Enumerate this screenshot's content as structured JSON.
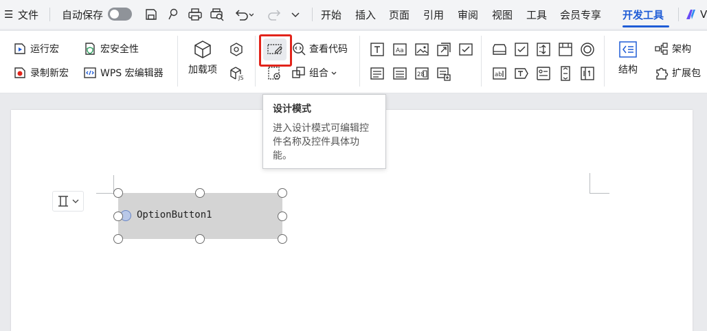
{
  "menubar": {
    "hamburger": "☰",
    "file": "文件",
    "autosave": "自动保存",
    "tabs": [
      "开始",
      "插入",
      "页面",
      "引用",
      "审阅",
      "视图",
      "工具",
      "会员专享",
      "开发工具"
    ],
    "active_tab": "开发工具",
    "cut_off_tab": "V"
  },
  "ribbon": {
    "run_macro": "运行宏",
    "macro_security": "宏安全性",
    "record_macro": "录制新宏",
    "wps_macro_editor": "WPS 宏编辑器",
    "addins": "加载项",
    "view_code": "查看代码",
    "group": "组合",
    "structure": "结构",
    "schema": "架构",
    "expansion_pack": "扩展包"
  },
  "tooltip": {
    "title": "设计模式",
    "description": "进入设计模式可编辑控件名称及控件具体功能。"
  },
  "control": {
    "caption": "OptionButton1"
  },
  "colors": {
    "accent": "#1f5cd6",
    "highlight_box": "#e2231a"
  }
}
